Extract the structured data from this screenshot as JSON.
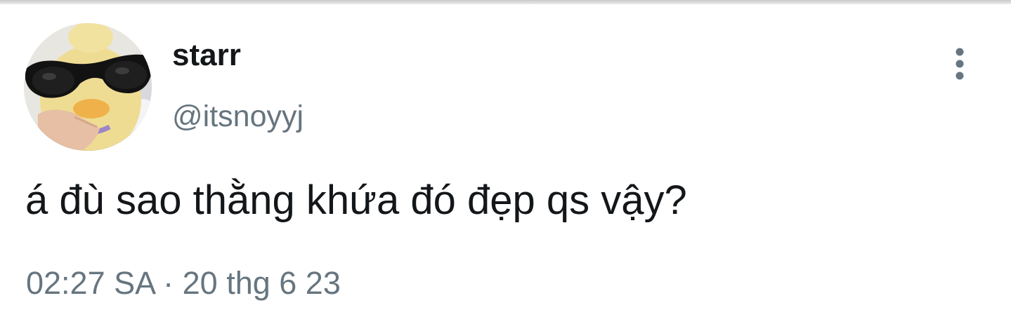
{
  "tweet": {
    "display_name": "starr",
    "handle": "@itsnoyyj",
    "text": "á đù sao thằng khứa đó đẹp qs vậy?",
    "timestamp": "02:27 SA · 20 thg 6 23"
  },
  "icons": {
    "avatar": "avatar-duck-sunglasses",
    "more": "more-vertical-icon"
  },
  "colors": {
    "text_primary": "#14171a",
    "text_secondary": "#66757f",
    "background": "#ffffff"
  }
}
